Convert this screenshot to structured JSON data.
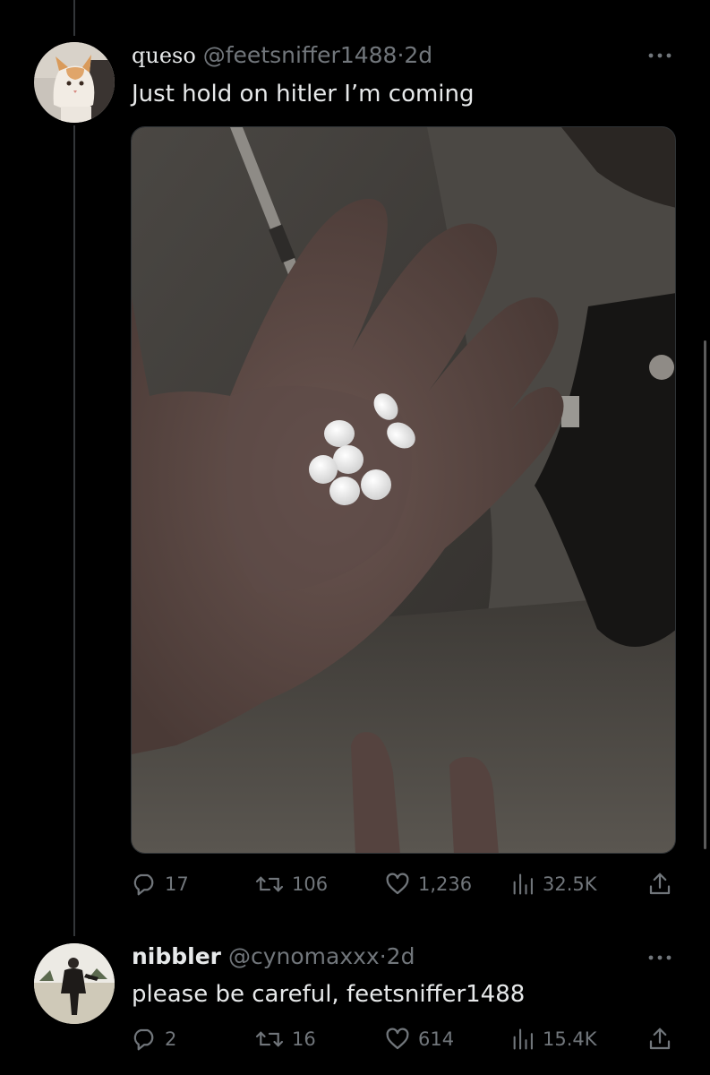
{
  "tweet": {
    "display_name": "queso",
    "handle": "@feetsniffer1488",
    "separator": "·",
    "time": "2d",
    "text": "Just hold on hitler I’m coming",
    "media_icon": "photo-hand-with-pills",
    "stats": {
      "replies": "17",
      "retweets": "106",
      "likes": "1,236",
      "views": "32.5K"
    }
  },
  "reply": {
    "display_name": "nibbler",
    "handle": "@cynomaxxx",
    "separator": "·",
    "time": "2d",
    "text": "please be careful, feetsniffer1488",
    "stats": {
      "replies": "2",
      "retweets": "16",
      "likes": "614",
      "views": "15.4K"
    }
  },
  "icons": {
    "reply": "reply-icon",
    "retweet": "retweet-icon",
    "like": "heart-icon",
    "views": "views-icon",
    "share": "share-icon",
    "more": "more-icon"
  },
  "colors": {
    "background": "#000000",
    "text": "#e7e9ea",
    "muted": "#71767b",
    "divider": "#333639"
  }
}
